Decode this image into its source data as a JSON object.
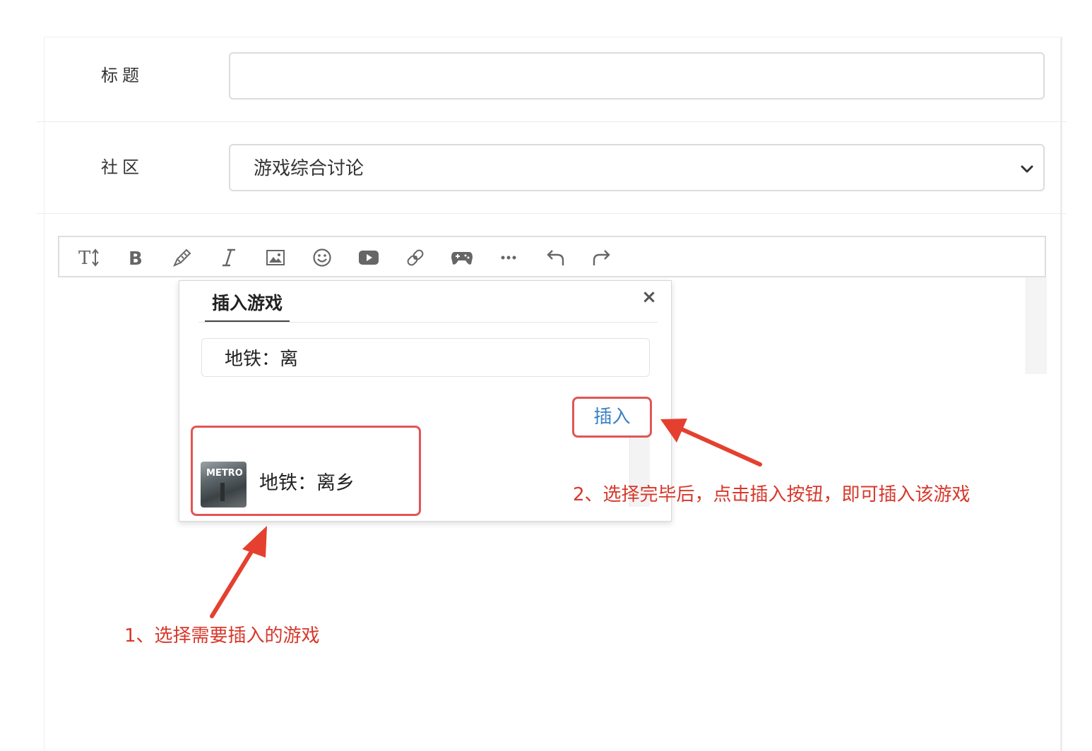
{
  "form": {
    "title_label": "标题",
    "title_value": "",
    "community_label": "社区",
    "community_selected": "游戏综合讨论"
  },
  "toolbar": {
    "buttons": [
      "text-size-icon",
      "bold-icon",
      "highlight-pen-icon",
      "italic-icon",
      "image-icon",
      "emoji-icon",
      "video-icon",
      "link-icon",
      "gamepad-icon",
      "more-icon",
      "undo-icon",
      "redo-icon"
    ]
  },
  "popup": {
    "tab_label": "插入游戏",
    "close_glyph": "×",
    "search_value": "地铁：离",
    "insert_label": "插入",
    "results": [
      {
        "name": "地铁：离乡",
        "cover_text": "METRO"
      }
    ]
  },
  "annotations": {
    "step1": "1、选择需要插入的游戏",
    "step2": "2、选择完毕后，点击插入按钮，即可插入该游戏",
    "color": "#d7382b"
  }
}
